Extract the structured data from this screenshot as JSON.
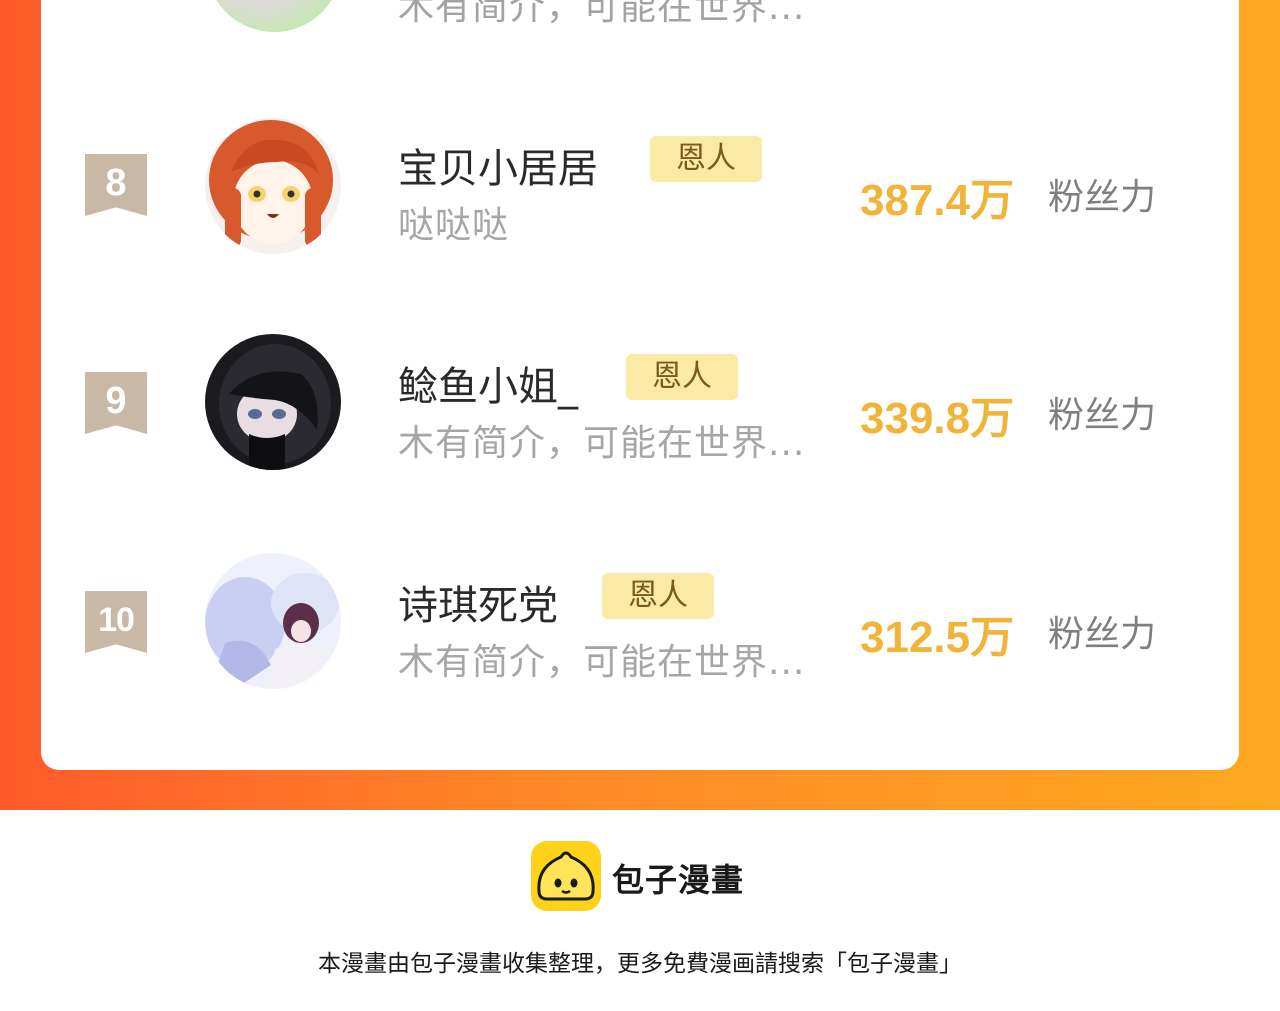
{
  "previous_row": {
    "description": "木有简介，可能在世界..."
  },
  "ranking": [
    {
      "rank": "8",
      "name": "宝贝小居居",
      "badge": "恩人",
      "description": "哒哒哒",
      "fans_value": "387.4万",
      "fans_label": "粉丝力"
    },
    {
      "rank": "9",
      "name": "鲶鱼小姐_",
      "badge": "恩人",
      "description": "木有简介，可能在世界...",
      "fans_value": "339.8万",
      "fans_label": "粉丝力"
    },
    {
      "rank": "10",
      "name": "诗琪死党",
      "badge": "恩人",
      "description": "木有简介，可能在世界...",
      "fans_value": "312.5万",
      "fans_label": "粉丝力"
    }
  ],
  "footer": {
    "brand_name": "包子漫畫",
    "credit_text": "本漫畫由包子漫畫收集整理，更多免費漫画請搜索「包子漫畫」"
  },
  "colors": {
    "gradient_start": "#ff5a2a",
    "gradient_end": "#ffa821",
    "fans_value": "#f1b43a",
    "badge_bg": "#fbeaa6",
    "rank_bg": "#c9b8a6",
    "logo_yellow": "#ffd21a"
  },
  "icons": {
    "rank_ribbon": "ribbon-bookmark-icon",
    "logo": "bun-mascot-icon"
  }
}
